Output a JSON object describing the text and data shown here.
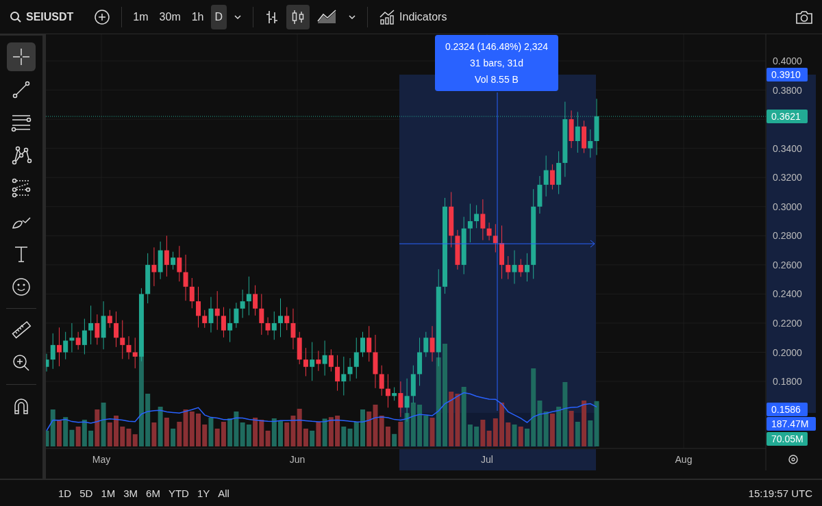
{
  "toolbar": {
    "symbol": "SEIUSDT",
    "intervals": [
      {
        "label": "1m",
        "selected": false
      },
      {
        "label": "30m",
        "selected": false
      },
      {
        "label": "1h",
        "selected": false
      },
      {
        "label": "D",
        "selected": true
      }
    ],
    "chart_styles": [
      {
        "kind": "bars",
        "selected": false
      },
      {
        "kind": "candles",
        "selected": true
      },
      {
        "kind": "area",
        "selected": false
      }
    ],
    "indicators": "Indicators"
  },
  "drawing_tools": [
    {
      "kind": "crosshair",
      "selected": true
    },
    {
      "kind": "trend-line",
      "selected": false
    },
    {
      "kind": "fib",
      "selected": false
    },
    {
      "kind": "pattern",
      "selected": false
    },
    {
      "kind": "projection",
      "selected": false
    },
    {
      "kind": "brush",
      "selected": false
    },
    {
      "kind": "text",
      "selected": false
    },
    {
      "kind": "emoji",
      "selected": false
    },
    {
      "kind": "ruler",
      "selected": false
    },
    {
      "kind": "zoom",
      "selected": false
    },
    {
      "kind": "magnet",
      "selected": false
    }
  ],
  "measure_tooltip": [
    "0.2324 (146.48%) 2,324",
    "31 bars, 31d",
    "Vol 8.55 B"
  ],
  "price_axis": {
    "ticks": [
      "0.4000",
      "0.3800",
      "0.3400",
      "0.3200",
      "0.3000",
      "0.2800",
      "0.2600",
      "0.2400",
      "0.2200",
      "0.2000",
      "0.1800"
    ],
    "tags": [
      {
        "label": "0.3910",
        "kind": "range"
      },
      {
        "label": "0.3621",
        "kind": "last"
      },
      {
        "label": "0.1586",
        "kind": "range"
      },
      {
        "label": "187.47M",
        "kind": "range"
      },
      {
        "label": "70.05M",
        "kind": "last"
      }
    ]
  },
  "time_axis": [
    "May",
    "Jun",
    "Jul",
    "Aug"
  ],
  "ranges": [
    "1D",
    "5D",
    "1M",
    "3M",
    "6M",
    "YTD",
    "1Y",
    "All"
  ],
  "clock": "15:19:57 UTC"
}
